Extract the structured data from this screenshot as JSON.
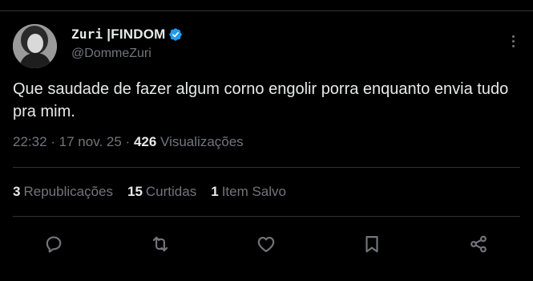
{
  "tweet": {
    "author": {
      "name_prefix": "Zuri",
      "name_suffix": "|FINDOM",
      "handle": "@DommeZuri",
      "verified": true
    },
    "text": "Que saudade de fazer algum corno engolir porra enquanto envia tudo pra mim.",
    "time": "22:32",
    "date": "17 nov. 25",
    "views_count": "426",
    "views_label": "Visualizações",
    "stats": {
      "reposts_count": "3",
      "reposts_label": "Republicações",
      "likes_count": "15",
      "likes_label": "Curtidas",
      "saves_count": "1",
      "saves_label": "Item Salvo"
    }
  },
  "colors": {
    "background": "#000000",
    "text": "#e7e9ea",
    "secondary": "#71767b",
    "divider": "#2f3336",
    "verified": "#1d9bf0"
  },
  "icons": [
    "verified-badge-icon",
    "more-options-icon",
    "reply-icon",
    "repost-icon",
    "like-icon",
    "bookmark-icon",
    "share-icon"
  ]
}
